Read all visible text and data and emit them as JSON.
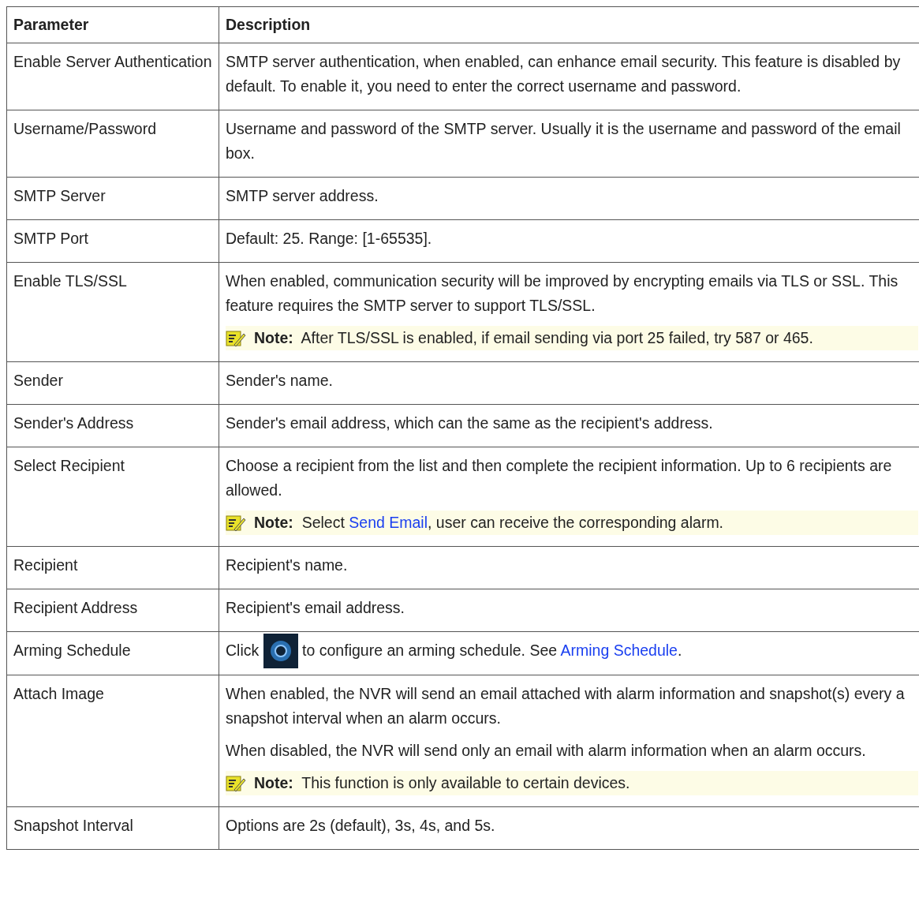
{
  "table": {
    "columns": [
      "Parameter",
      "Description"
    ],
    "rows": [
      {
        "parameter": "Enable Server Authentication",
        "blocks": [
          {
            "kind": "text",
            "parts": [
              {
                "kind": "text",
                "text": "SMTP server authentication, when enabled, can enhance email security. This feature is disabled by default. To enable it, you need to enter the correct username and password."
              }
            ]
          }
        ]
      },
      {
        "parameter": "Username/Password",
        "blocks": [
          {
            "kind": "text",
            "parts": [
              {
                "kind": "text",
                "text": "Username and password of the SMTP server. Usually it is the username and password of the email box."
              }
            ]
          }
        ]
      },
      {
        "parameter": "SMTP Server",
        "blocks": [
          {
            "kind": "text",
            "parts": [
              {
                "kind": "text",
                "text": "SMTP server address."
              }
            ]
          }
        ]
      },
      {
        "parameter": "SMTP Port",
        "blocks": [
          {
            "kind": "text",
            "parts": [
              {
                "kind": "text",
                "text": "Default: 25. Range: [1-65535]."
              }
            ]
          }
        ]
      },
      {
        "parameter": "Enable TLS/SSL",
        "blocks": [
          {
            "kind": "text",
            "parts": [
              {
                "kind": "text",
                "text": "When enabled, communication security will be improved by encrypting emails via TLS or SSL. This feature requires the SMTP server to support TLS/SSL."
              }
            ]
          },
          {
            "kind": "note",
            "label": "Note:",
            "parts": [
              {
                "kind": "text",
                "text": "After TLS/SSL is enabled, if email sending via port 25 failed, try 587 or 465."
              }
            ]
          }
        ]
      },
      {
        "parameter": "Sender",
        "blocks": [
          {
            "kind": "text",
            "parts": [
              {
                "kind": "text",
                "text": "Sender's name."
              }
            ]
          }
        ]
      },
      {
        "parameter": "Sender's Address",
        "blocks": [
          {
            "kind": "text",
            "parts": [
              {
                "kind": "text",
                "text": "Sender's email address, which can the same as the recipient's address."
              }
            ]
          }
        ]
      },
      {
        "parameter": "Select Recipient",
        "blocks": [
          {
            "kind": "text",
            "parts": [
              {
                "kind": "text",
                "text": "Choose a recipient from the list and then complete the recipient information. Up to 6 recipients are allowed."
              }
            ]
          },
          {
            "kind": "note",
            "label": "Note:",
            "parts": [
              {
                "kind": "text",
                "text": "Select "
              },
              {
                "kind": "link",
                "text": "Send Email"
              },
              {
                "kind": "text",
                "text": ", user can receive the corresponding alarm."
              }
            ]
          }
        ]
      },
      {
        "parameter": "Recipient",
        "blocks": [
          {
            "kind": "text",
            "parts": [
              {
                "kind": "text",
                "text": "Recipient's name."
              }
            ]
          }
        ]
      },
      {
        "parameter": "Recipient Address",
        "blocks": [
          {
            "kind": "text",
            "parts": [
              {
                "kind": "text",
                "text": "Recipient's email address."
              }
            ]
          }
        ]
      },
      {
        "parameter": "Arming Schedule",
        "blocks": [
          {
            "kind": "text",
            "parts": [
              {
                "kind": "text",
                "text": "Click "
              },
              {
                "kind": "icon"
              },
              {
                "kind": "text",
                "text": " to configure an arming schedule. See "
              },
              {
                "kind": "link",
                "text": "Arming Schedule"
              },
              {
                "kind": "text",
                "text": "."
              }
            ]
          }
        ]
      },
      {
        "parameter": "Attach Image",
        "blocks": [
          {
            "kind": "text",
            "parts": [
              {
                "kind": "text",
                "text": "When enabled, the NVR will send an email attached with alarm information and snapshot(s) every a snapshot interval when an alarm occurs."
              }
            ]
          },
          {
            "kind": "text",
            "parts": [
              {
                "kind": "text",
                "text": "When disabled, the NVR will send only an email with alarm information when an alarm occurs."
              }
            ]
          },
          {
            "kind": "note",
            "label": "Note:",
            "parts": [
              {
                "kind": "text",
                "text": "This function is only available to certain devices."
              }
            ]
          }
        ]
      },
      {
        "parameter": "Snapshot Interval",
        "blocks": [
          {
            "kind": "text",
            "parts": [
              {
                "kind": "text",
                "text": "Options are 2s (default), 3s, 4s, and 5s."
              }
            ]
          }
        ]
      }
    ]
  }
}
